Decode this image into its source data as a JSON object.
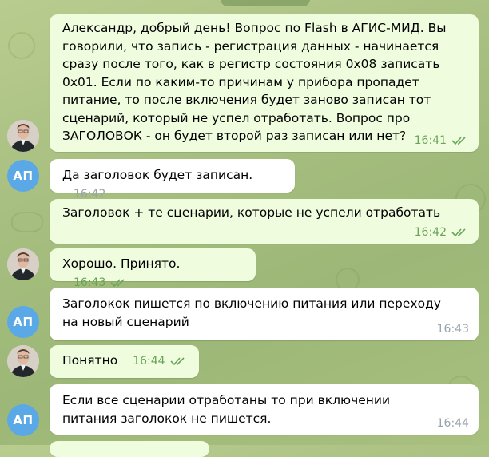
{
  "messages": [
    {
      "text": "Александр, добрый день! Вопрос по Flash в АГИС-МИД. Вы говорили, что запись - регистрация данных - начинается сразу после того, как в регистр состояния 0x08 записать 0x01. Если по каким-то причинам у прибора пропадет питание, то после включения будет заново записан тот сценарий, который не успел отработать. Вопрос про ЗАГОЛОВОК - он будет второй раз записан или нет?",
      "time": "16:41",
      "outgoing": true
    },
    {
      "text": "Да заголовок будет записан.",
      "time": "16:42",
      "outgoing": false
    },
    {
      "text": "Заголовок + те сценарии, которые не успели отработать",
      "time": "16:42",
      "outgoing": true
    },
    {
      "text": "Хорошо. Принято.",
      "time": "16:43",
      "outgoing": true
    },
    {
      "text": "Заголокок пишется по включению питания или переходу на новый сценарий",
      "time": "16:43",
      "outgoing": false
    },
    {
      "text": "Понятно",
      "time": "16:44",
      "outgoing": true
    },
    {
      "text": "Если все сценарии отработаны то при включении питания заголокок не пишется.",
      "time": "16:44",
      "outgoing": false
    }
  ],
  "avatars": {
    "remote_initials": "АП"
  },
  "colors": {
    "outgoing_bubble": "#effdde",
    "incoming_bubble": "#ffffff",
    "read_check": "#6aa45a",
    "avatar_initials_bg": "#5aa9e6"
  }
}
